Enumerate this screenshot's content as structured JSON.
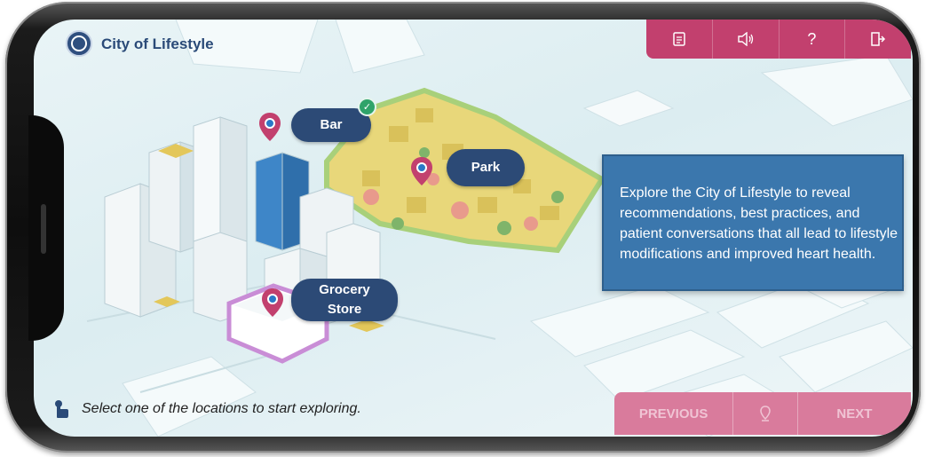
{
  "header": {
    "title": "City of Lifestyle",
    "logo_icon": "seal-logo-icon"
  },
  "toolbar": {
    "color": "#c2406e",
    "buttons": [
      {
        "name": "transcript",
        "icon": "document-icon",
        "glyph": "▤"
      },
      {
        "name": "audio",
        "icon": "speaker-icon",
        "glyph": "🔈"
      },
      {
        "name": "help",
        "icon": "help-icon",
        "glyph": "?"
      },
      {
        "name": "exit",
        "icon": "exit-icon",
        "glyph": "⇥"
      }
    ]
  },
  "map": {
    "locations": [
      {
        "label": "Bar",
        "visited": true
      },
      {
        "label": "Park",
        "visited": false
      },
      {
        "label": "Grocery\nStore",
        "visited": false
      }
    ],
    "pin_color": "#c2406e",
    "label_color": "#2c4a76"
  },
  "info": {
    "text": "Explore the City of Lifestyle to reveal recommendations, best practices, and patient conversations that all lead to lifestyle modifications and improved heart health."
  },
  "instruction": {
    "icon": "pointer-hand-icon",
    "text": "Select one of the locations to start exploring."
  },
  "navigation": {
    "previous_label": "PREVIOUS",
    "middle_icon": "location-pin-icon",
    "next_label": "NEXT",
    "color": "#d97b9c"
  }
}
